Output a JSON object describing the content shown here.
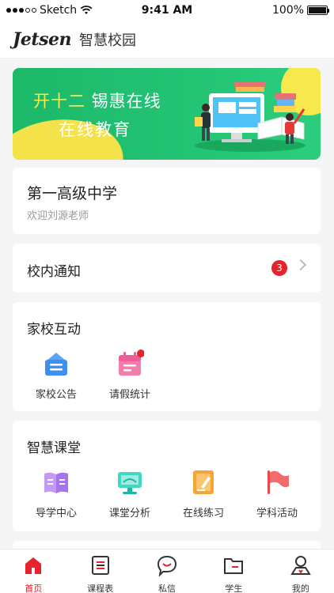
{
  "status_bar": {
    "carrier": "Sketch",
    "time": "9:41 AM",
    "battery": "100%"
  },
  "header": {
    "logo": "Jetsen",
    "title": "智慧校园"
  },
  "banner": {
    "line1_highlight": "开十二",
    "line1_rest": " 锡惠在线",
    "line2": "在线教育"
  },
  "school": {
    "name": "第一高级中学",
    "welcome": "欢迎刘源老师"
  },
  "notice": {
    "title": "校内通知",
    "badge_count": "3"
  },
  "home_school": {
    "title": "家校互动",
    "items": [
      {
        "label": "家校公告",
        "icon": "announcement-icon"
      },
      {
        "label": "请假统计",
        "icon": "leave-calendar-icon"
      }
    ]
  },
  "smart_class": {
    "title": "智慧课堂",
    "items": [
      {
        "label": "导学中心",
        "icon": "book-icon"
      },
      {
        "label": "课堂分析",
        "icon": "monitor-icon"
      },
      {
        "label": "在线练习",
        "icon": "pencil-notebook-icon"
      },
      {
        "label": "学科活动",
        "icon": "flag-icon"
      }
    ]
  },
  "tab_bar": {
    "tabs": [
      {
        "label": "首页",
        "icon": "home-icon",
        "active": true
      },
      {
        "label": "课程表",
        "icon": "schedule-icon",
        "active": false
      },
      {
        "label": "私信",
        "icon": "message-icon",
        "active": false
      },
      {
        "label": "学生",
        "icon": "folder-icon",
        "active": false
      },
      {
        "label": "我的",
        "icon": "profile-icon",
        "active": false
      }
    ]
  },
  "colors": {
    "accent": "#e8212c",
    "banner_green": "#23c374",
    "banner_yellow": "#f3e24a"
  }
}
